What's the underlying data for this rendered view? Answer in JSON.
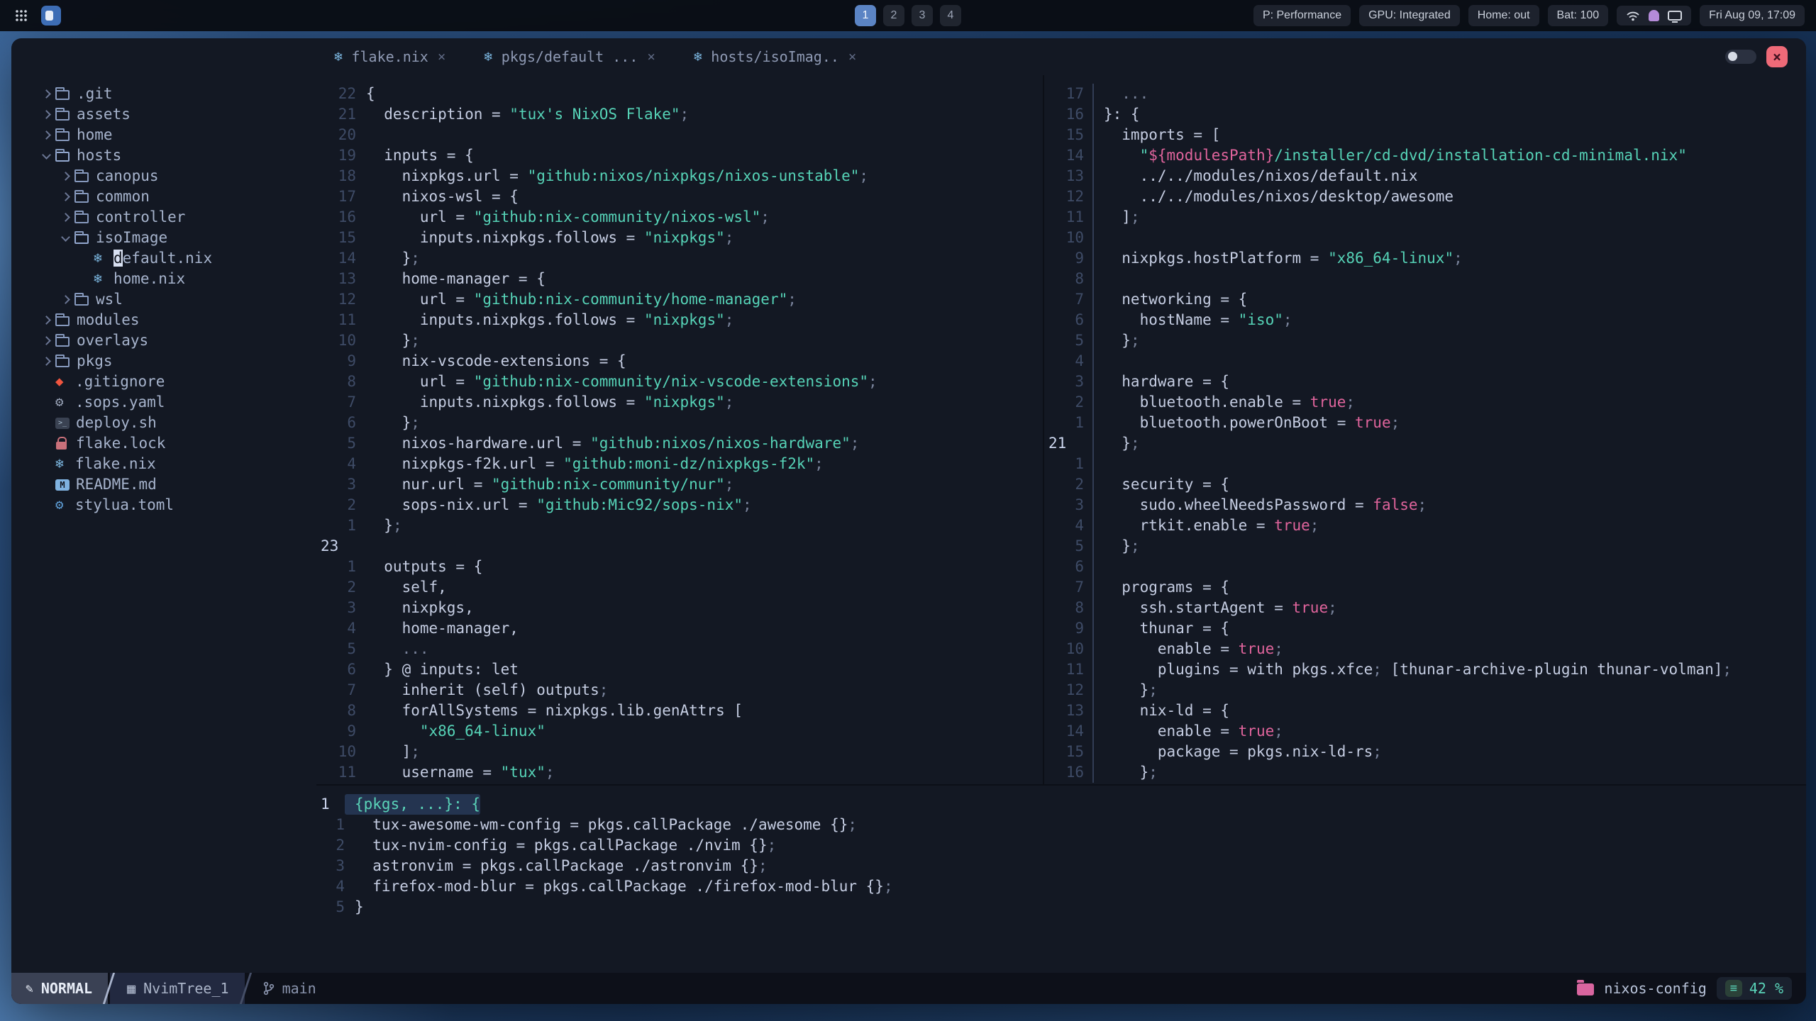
{
  "topbar": {
    "workspaces": [
      "1",
      "2",
      "3",
      "4"
    ],
    "active_workspace": "1",
    "right": {
      "power": "P: Performance",
      "gpu": "GPU: Integrated",
      "home": "Home: out",
      "battery": "Bat: 100",
      "clock": "Fri Aug 09, 17:09"
    }
  },
  "tabs": [
    {
      "label": "flake.nix"
    },
    {
      "label": "pkgs/default ..."
    },
    {
      "label": "hosts/isoImag.."
    }
  ],
  "tree": {
    "items": [
      {
        "indent": 0,
        "chevron": "right",
        "icon": "folder",
        "label": ".git"
      },
      {
        "indent": 0,
        "chevron": "right",
        "icon": "folder",
        "label": "assets"
      },
      {
        "indent": 0,
        "chevron": "right",
        "icon": "folder",
        "label": "home"
      },
      {
        "indent": 0,
        "chevron": "down",
        "icon": "folder-open",
        "label": "hosts"
      },
      {
        "indent": 1,
        "chevron": "right",
        "icon": "folder",
        "label": "canopus"
      },
      {
        "indent": 1,
        "chevron": "right",
        "icon": "folder",
        "label": "common"
      },
      {
        "indent": 1,
        "chevron": "right",
        "icon": "folder",
        "label": "controller"
      },
      {
        "indent": 1,
        "chevron": "down",
        "icon": "folder-open",
        "label": "isoImage"
      },
      {
        "indent": 2,
        "chevron": "none",
        "icon": "nix",
        "label": "default.nix",
        "cursor": true
      },
      {
        "indent": 2,
        "chevron": "none",
        "icon": "nix",
        "label": "home.nix"
      },
      {
        "indent": 1,
        "chevron": "right",
        "icon": "folder",
        "label": "wsl"
      },
      {
        "indent": 0,
        "chevron": "right",
        "icon": "folder",
        "label": "modules"
      },
      {
        "indent": 0,
        "chevron": "right",
        "icon": "folder",
        "label": "overlays"
      },
      {
        "indent": 0,
        "chevron": "right",
        "icon": "folder",
        "label": "pkgs"
      },
      {
        "indent": 0,
        "chevron": "none",
        "icon": "git",
        "label": ".gitignore"
      },
      {
        "indent": 0,
        "chevron": "none",
        "icon": "gear",
        "label": ".sops.yaml"
      },
      {
        "indent": 0,
        "chevron": "none",
        "icon": "script",
        "label": "deploy.sh"
      },
      {
        "indent": 0,
        "chevron": "none",
        "icon": "lock",
        "label": "flake.lock"
      },
      {
        "indent": 0,
        "chevron": "none",
        "icon": "nix",
        "label": "flake.nix"
      },
      {
        "indent": 0,
        "chevron": "none",
        "icon": "markdown",
        "label": "README.md"
      },
      {
        "indent": 0,
        "chevron": "none",
        "icon": "gear-blue",
        "label": "stylua.toml"
      }
    ]
  },
  "editors": {
    "flake": {
      "numbers": [
        "22",
        "21",
        "20",
        "19",
        "18",
        "17",
        "16",
        "15",
        "14",
        "13",
        "12",
        "11",
        "10",
        "9",
        "8",
        "7",
        "6",
        "5",
        "4",
        "3",
        "2",
        "1",
        "23",
        "1",
        "2",
        "3",
        "4",
        "5",
        "6",
        "7",
        "8",
        "9",
        "10",
        "11"
      ],
      "current_line_index": 22,
      "gutter_divider": false,
      "highlight_current_text": false,
      "lines": [
        "{",
        "  description = \"tux's NixOS Flake\";",
        "",
        "  inputs = {",
        "    nixpkgs.url = \"github:nixos/nixpkgs/nixos-unstable\";",
        "    nixos-wsl = {",
        "      url = \"github:nix-community/nixos-wsl\";",
        "      inputs.nixpkgs.follows = \"nixpkgs\";",
        "    };",
        "    home-manager = {",
        "      url = \"github:nix-community/home-manager\";",
        "      inputs.nixpkgs.follows = \"nixpkgs\";",
        "    };",
        "    nix-vscode-extensions = {",
        "      url = \"github:nix-community/nix-vscode-extensions\";",
        "      inputs.nixpkgs.follows = \"nixpkgs\";",
        "    };",
        "    nixos-hardware.url = \"github:nixos/nixos-hardware\";",
        "    nixpkgs-f2k.url = \"github:moni-dz/nixpkgs-f2k\";",
        "    nur.url = \"github:nix-community/nur\";",
        "    sops-nix.url = \"github:Mic92/sops-nix\";",
        "  };",
        "",
        "  outputs = {",
        "    self,",
        "    nixpkgs,",
        "    home-manager,",
        "    ...",
        "  } @ inputs: let",
        "    inherit (self) outputs;",
        "    forAllSystems = nixpkgs.lib.genAttrs [",
        "      \"x86_64-linux\"",
        "    ];",
        "    username = \"tux\";"
      ]
    },
    "iso": {
      "numbers": [
        "17",
        "16",
        "15",
        "14",
        "13",
        "12",
        "11",
        "10",
        "9",
        "8",
        "7",
        "6",
        "5",
        "4",
        "3",
        "2",
        "1",
        "21",
        "1",
        "2",
        "3",
        "4",
        "5",
        "6",
        "7",
        "8",
        "9",
        "10",
        "11",
        "12",
        "13",
        "14",
        "15",
        "16"
      ],
      "current_line_index": 17,
      "gutter_divider": true,
      "highlight_current_text": false,
      "lines": [
        "  ...",
        "}: {",
        "  imports = [",
        "    \"${modulesPath}/installer/cd-dvd/installation-cd-minimal.nix\"",
        "    ../../modules/nixos/default.nix",
        "    ../../modules/nixos/desktop/awesome",
        "  ];",
        "",
        "  nixpkgs.hostPlatform = \"x86_64-linux\";",
        "",
        "  networking = {",
        "    hostName = \"iso\";",
        "  };",
        "",
        "  hardware = {",
        "    bluetooth.enable = true;",
        "    bluetooth.powerOnBoot = true;",
        "  };",
        "",
        "  security = {",
        "    sudo.wheelNeedsPassword = false;",
        "    rtkit.enable = true;",
        "  };",
        "",
        "  programs = {",
        "    ssh.startAgent = true;",
        "    thunar = {",
        "      enable = true;",
        "      plugins = with pkgs.xfce; [thunar-archive-plugin thunar-volman];",
        "    };",
        "    nix-ld = {",
        "      enable = true;",
        "      package = pkgs.nix-ld-rs;",
        "    };"
      ]
    },
    "pkgs": {
      "numbers": [
        "1",
        "1",
        "2",
        "3",
        "4",
        "5"
      ],
      "current_line_index": 0,
      "gutter_divider": false,
      "highlight_current_text": true,
      "lines": [
        "{pkgs, ...}: {",
        "  tux-awesome-wm-config = pkgs.callPackage ./awesome {};",
        "  tux-nvim-config = pkgs.callPackage ./nvim {};",
        "  astronvim = pkgs.callPackage ./astronvim {};",
        "  firefox-mod-blur = pkgs.callPackage ./firefox-mod-blur {};",
        "}"
      ]
    }
  },
  "statusline": {
    "mode": "NORMAL",
    "buffer": "NvimTree_1",
    "branch": "main",
    "project": "nixos-config",
    "scroll_percent": "42 %"
  },
  "glyphs": {
    "nix": "❄",
    "gear": "⚙",
    "diamond": "◆",
    "pencil": "✎",
    "tree_panel": "▦",
    "menu": "≡",
    "close": "×",
    "script": ">_",
    "markdown": "M"
  },
  "colors": {
    "window_bg": "#131823",
    "bar_bg": "#090c13",
    "accent_blue": "#7ebae4",
    "string_teal": "#56d3b7",
    "bool_pink": "#e0649c",
    "active_workspace": "#5b84c4",
    "close_red": "#ee6a78",
    "project_pink": "#d9659f",
    "mode_segment": "#3a4154"
  }
}
